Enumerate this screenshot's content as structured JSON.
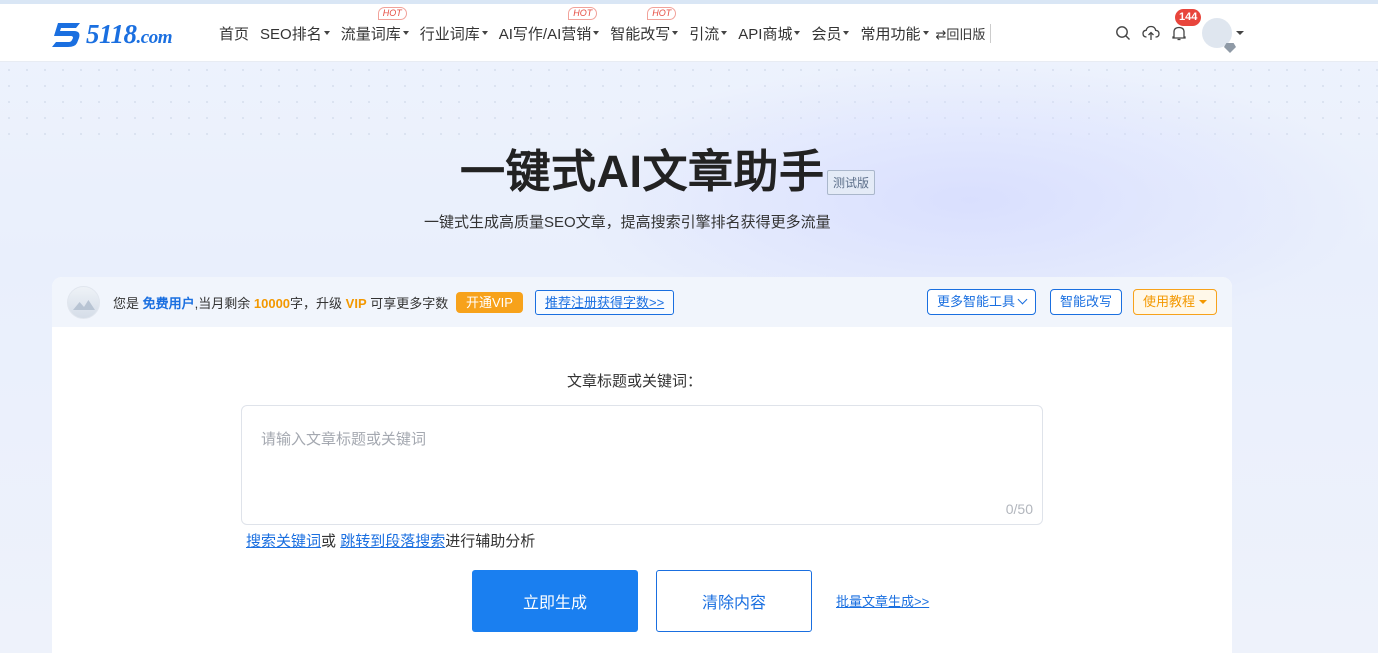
{
  "logo": {
    "brand": "5118",
    "tld": ".com"
  },
  "nav": {
    "items": [
      {
        "label": "首页",
        "caret": false,
        "hot": ""
      },
      {
        "label": "SEO排名",
        "caret": true,
        "hot": ""
      },
      {
        "label": "流量词库",
        "caret": true,
        "hot": "HOT"
      },
      {
        "label": "行业词库",
        "caret": true,
        "hot": ""
      },
      {
        "label": "AI写作/AI营销",
        "caret": true,
        "hot": "HOT"
      },
      {
        "label": "智能改写",
        "caret": true,
        "hot": "HOT"
      },
      {
        "label": "引流",
        "caret": true,
        "hot": ""
      },
      {
        "label": "API商城",
        "caret": true,
        "hot": ""
      },
      {
        "label": "会员",
        "caret": true,
        "hot": ""
      },
      {
        "label": "常用功能",
        "caret": true,
        "hot": ""
      }
    ],
    "old_version": "⇄回旧版",
    "notification_count": "144",
    "icons": [
      "search-icon",
      "cloud-upload-icon",
      "bell-icon"
    ]
  },
  "hero": {
    "title": "一键式AI文章助手",
    "beta_tag": "测试版",
    "subtitle": "一键式生成高质量SEO文章，提高搜索引擎排名获得更多流量"
  },
  "account_bar": {
    "prefix": "您是 ",
    "user_type": "免费用户",
    "mid1": ",当月剩余 ",
    "remaining": "10000",
    "mid2": "字，升级 ",
    "vip": "VIP",
    "suffix": " 可享更多字数",
    "vip_button": "开通VIP",
    "referral_link": "推荐注册获得字数>>",
    "more_tools": "更多智能工具",
    "rewrite": "智能改写",
    "tutorial": "使用教程"
  },
  "form": {
    "label": "文章标题或关键词：",
    "placeholder": "请输入文章标题或关键词",
    "counter": "0/50",
    "assist_link1": "搜索关键词",
    "assist_or": "或 ",
    "assist_link2": "跳转到段落搜索",
    "assist_suffix": "进行辅助分析",
    "generate": "立即生成",
    "clear": "清除内容",
    "batch": "批量文章生成>>"
  },
  "colors": {
    "brand": "#1a6fe0",
    "accent": "#f7a21b",
    "hot": "#e54d42"
  }
}
